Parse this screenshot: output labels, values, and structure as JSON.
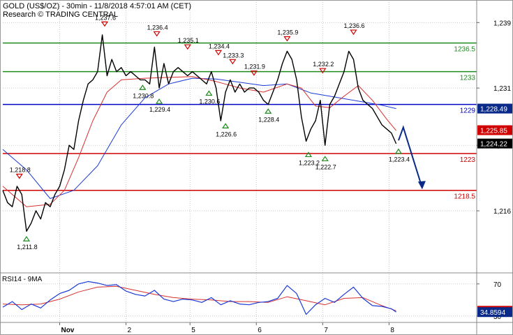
{
  "header": {
    "title": "GOLD (US$/OZ) - 30min - 11/8/2018 4:57:01 AM (CET)",
    "source": "Research © TRADING CENTRAL"
  },
  "chart_data": [
    {
      "type": "line",
      "panel": "price",
      "ylim": [
        1208.5,
        1241.5
      ],
      "xlim": [
        0,
        100
      ],
      "y_ticks": [
        {
          "v": 1239,
          "label": "1,239"
        },
        {
          "v": 1231,
          "label": "1,231"
        },
        {
          "v": 1224,
          "label": "1,224"
        },
        {
          "v": 1216,
          "label": "1,216"
        }
      ],
      "x_ticks": [
        {
          "x": 12.0,
          "label": "Nov"
        },
        {
          "x": 26.0,
          "label": "2"
        },
        {
          "x": 39.5,
          "label": "5"
        },
        {
          "x": 53.5,
          "label": "6"
        },
        {
          "x": 67.5,
          "label": "7"
        },
        {
          "x": 81.5,
          "label": "8"
        }
      ],
      "levels": [
        {
          "value": 1236.5,
          "label": "1236.5",
          "color": "#1e8a1e"
        },
        {
          "value": 1233,
          "label": "1233",
          "color": "#1e8a1e"
        },
        {
          "value": 1229,
          "label": "1229",
          "color": "#0000c8"
        },
        {
          "value": 1223,
          "label": "1223",
          "color": "#d00000"
        },
        {
          "value": 1218.5,
          "label": "1218.5",
          "color": "#d00000"
        }
      ],
      "price_tags": [
        {
          "value": 1228.49,
          "label": "1,228.49",
          "color": "#0a2a8a"
        },
        {
          "value": 1225.85,
          "label": "1,225.85",
          "color": "#d00000"
        },
        {
          "value": 1224.22,
          "label": "1,224.22",
          "color": "#000000"
        }
      ],
      "pivots": [
        {
          "x": 3.5,
          "y": 1219.8,
          "label": "1,218.8",
          "kind": "high"
        },
        {
          "x": 5.0,
          "y": 1213.0,
          "label": "1,211.8",
          "kind": "low"
        },
        {
          "x": 21.5,
          "y": 1238.4,
          "label": "1,237.6",
          "kind": "high"
        },
        {
          "x": 29.5,
          "y": 1231.5,
          "label": "1,230.8",
          "kind": "low"
        },
        {
          "x": 32.5,
          "y": 1237.2,
          "label": "1,236.4",
          "kind": "high"
        },
        {
          "x": 33.0,
          "y": 1229.8,
          "label": "1,229.4",
          "kind": "low"
        },
        {
          "x": 39.0,
          "y": 1235.6,
          "label": "1,235.1",
          "kind": "high"
        },
        {
          "x": 43.5,
          "y": 1230.8,
          "label": "1,230.6",
          "kind": "low"
        },
        {
          "x": 45.5,
          "y": 1234.9,
          "label": "1,234.4",
          "kind": "high"
        },
        {
          "x": 47.0,
          "y": 1226.8,
          "label": "1,226.6",
          "kind": "low"
        },
        {
          "x": 48.5,
          "y": 1233.8,
          "label": "1,233.3",
          "kind": "high"
        },
        {
          "x": 53.0,
          "y": 1232.4,
          "label": "1,231.9",
          "kind": "high"
        },
        {
          "x": 56.0,
          "y": 1228.6,
          "label": "1,228.4",
          "kind": "low"
        },
        {
          "x": 60.0,
          "y": 1236.6,
          "label": "1,235.9",
          "kind": "high"
        },
        {
          "x": 64.5,
          "y": 1223.3,
          "label": "1,223.2",
          "kind": "low"
        },
        {
          "x": 67.5,
          "y": 1232.7,
          "label": "1,232.2",
          "kind": "high"
        },
        {
          "x": 68.0,
          "y": 1222.8,
          "label": "1,222.7",
          "kind": "low"
        },
        {
          "x": 74.0,
          "y": 1237.4,
          "label": "1,236.6",
          "kind": "high"
        },
        {
          "x": 83.5,
          "y": 1223.7,
          "label": "1,223.4",
          "kind": "low"
        }
      ],
      "series": [
        {
          "key": "price",
          "color": "#000000",
          "x": [
            0,
            1,
            2,
            3,
            4,
            5,
            6,
            7,
            8,
            9,
            10,
            11,
            12,
            13,
            14,
            15,
            16,
            17,
            18,
            19,
            20,
            21,
            22,
            23,
            24,
            25,
            26,
            27,
            28,
            29,
            30,
            31,
            32,
            33,
            34,
            35,
            36,
            37,
            38,
            39,
            40,
            41,
            42,
            43,
            44,
            45,
            46,
            47,
            48,
            49,
            50,
            51,
            52,
            53,
            54,
            55,
            56,
            57,
            58,
            59,
            60,
            61,
            62,
            63,
            64,
            65,
            66,
            67,
            68,
            69,
            70,
            71,
            72,
            73,
            74,
            75,
            76,
            77,
            78,
            79,
            80,
            81,
            82,
            83
          ],
          "values": [
            1218.5,
            1217,
            1216.5,
            1219,
            1218,
            1213.5,
            1214.5,
            1216,
            1215,
            1217,
            1216.5,
            1218,
            1219,
            1221,
            1224,
            1223.5,
            1227,
            1229.5,
            1231.5,
            1232,
            1233,
            1237.5,
            1232.5,
            1234.5,
            1233,
            1233.5,
            1232.5,
            1233,
            1232.5,
            1232,
            1232,
            1231.5,
            1236,
            1231,
            1234,
            1231.5,
            1233,
            1233.5,
            1233,
            1232.5,
            1233,
            1232.5,
            1232,
            1231.5,
            1233,
            1231,
            1227,
            1230.5,
            1232,
            1230.5,
            1231.5,
            1230.5,
            1231,
            1231,
            1230.5,
            1229.5,
            1229,
            1230.5,
            1232,
            1234,
            1235.5,
            1234.5,
            1232,
            1227.5,
            1224.5,
            1226,
            1227,
            1229.5,
            1224,
            1229,
            1230,
            1231.5,
            1233,
            1235.5,
            1234.5,
            1231,
            1229.5,
            1229,
            1228.5,
            1227.5,
            1226.5,
            1226,
            1225.5,
            1224.2
          ]
        },
        {
          "key": "ma_red",
          "color": "#d83030",
          "x": [
            0,
            5,
            10,
            13,
            16,
            19,
            22,
            25,
            30,
            35,
            40,
            45,
            50,
            55,
            60,
            63,
            66,
            69,
            72,
            75,
            78,
            81,
            83
          ],
          "values": [
            1219,
            1216.5,
            1216.8,
            1218.5,
            1222.5,
            1227,
            1230.5,
            1232,
            1232.2,
            1232.3,
            1232.4,
            1231.8,
            1231,
            1230.5,
            1231.5,
            1231,
            1228.8,
            1228.6,
            1230,
            1231.3,
            1229.5,
            1227.2,
            1225.8
          ]
        },
        {
          "key": "ma_blue",
          "color": "#1a3ad6",
          "x": [
            0,
            5,
            10,
            15,
            20,
            25,
            30,
            35,
            40,
            45,
            50,
            55,
            60,
            65,
            70,
            75,
            80,
            83
          ],
          "values": [
            1223.5,
            1221,
            1217.5,
            1218.5,
            1221.5,
            1226.5,
            1229.8,
            1231.5,
            1232.2,
            1232.1,
            1231.7,
            1231.3,
            1231.5,
            1230.4,
            1229.9,
            1229.4,
            1228.9,
            1228.49
          ]
        }
      ],
      "projection": {
        "x": [
          83.5,
          84.5,
          88.5
        ],
        "values": [
          1224.6,
          1226.2,
          1218.8
        ],
        "color": "#0a2a8a"
      }
    },
    {
      "type": "line",
      "panel": "rsi",
      "title": "RSI14 - 9MA",
      "ylim": [
        22,
        82
      ],
      "y_ticks": [
        {
          "v": 70,
          "label": "70"
        },
        {
          "v": 30,
          "label": "30"
        }
      ],
      "value_tags": [
        {
          "value": 36.5216,
          "label": "36.5216",
          "color": "#d00000"
        },
        {
          "value": 34.8594,
          "label": "34.8594",
          "color": "#0a2a8a"
        }
      ],
      "series": [
        {
          "key": "rsi",
          "color": "#1a3ad6",
          "x": [
            0,
            2,
            4,
            6,
            8,
            10,
            12,
            14,
            16,
            18,
            20,
            22,
            24,
            26,
            28,
            30,
            32,
            34,
            36,
            38,
            40,
            42,
            44,
            46,
            48,
            50,
            52,
            54,
            56,
            58,
            60,
            62,
            64,
            66,
            68,
            70,
            72,
            74,
            76,
            78,
            80,
            82,
            83
          ],
          "values": [
            41,
            48,
            38,
            45,
            40,
            50,
            58,
            62,
            70,
            73,
            71,
            68,
            69,
            61,
            57,
            55,
            62,
            51,
            48,
            51,
            50,
            47,
            53,
            44,
            49,
            45,
            44,
            47,
            48,
            52,
            68,
            58,
            32,
            44,
            52,
            47,
            57,
            66,
            52,
            43,
            42,
            39,
            35
          ]
        },
        {
          "key": "rsi_ma",
          "color": "#d83030",
          "x": [
            0,
            4,
            8,
            12,
            16,
            20,
            24,
            28,
            32,
            36,
            40,
            44,
            48,
            52,
            56,
            60,
            64,
            68,
            72,
            76,
            80,
            83
          ],
          "values": [
            45,
            44,
            45,
            51,
            60,
            66,
            67,
            62,
            57,
            53,
            51,
            50,
            48,
            48,
            47,
            54,
            49,
            44,
            52,
            53,
            43,
            36.5
          ]
        }
      ]
    }
  ]
}
